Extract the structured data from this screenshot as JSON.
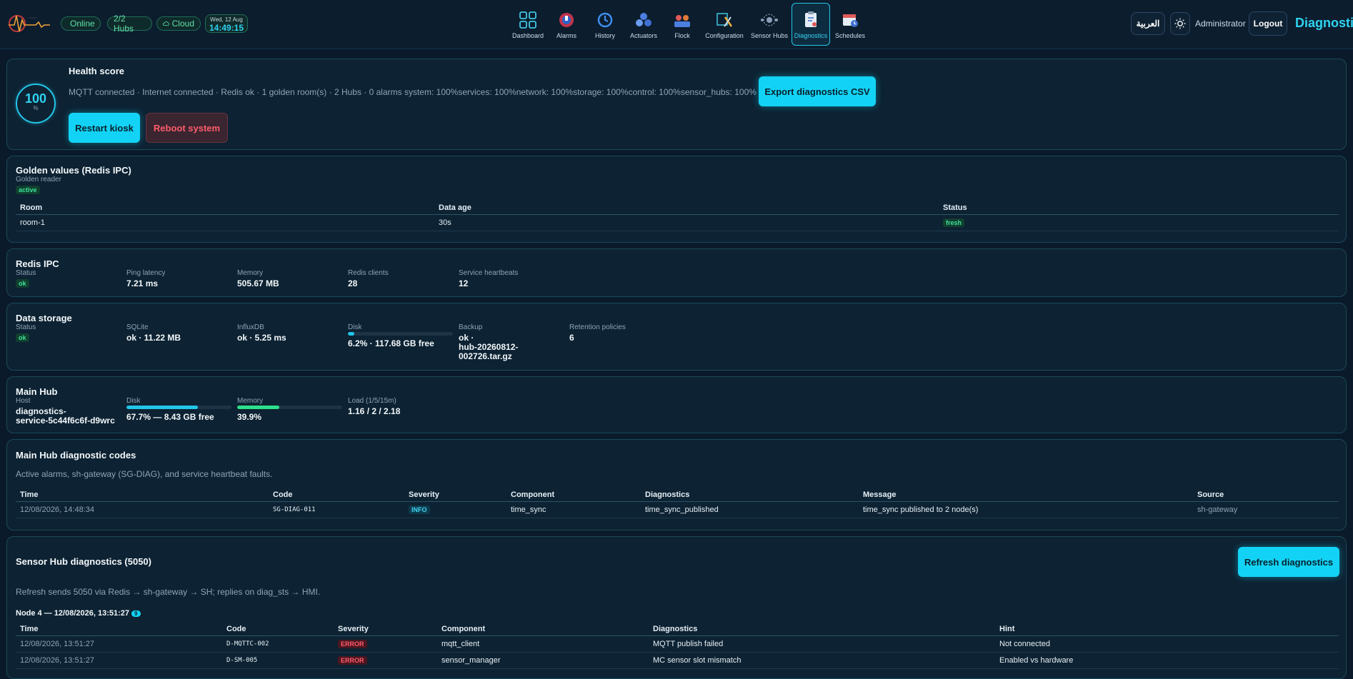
{
  "header": {
    "status_online": "Online",
    "hubs": "2/2 Hubs",
    "cloud": "Cloud",
    "date": "Wed, 12 Aug",
    "time": "14:49:15",
    "nav": [
      {
        "label": "Dashboard",
        "icon": "dashboard-icon"
      },
      {
        "label": "Alarms",
        "icon": "alarm-icon"
      },
      {
        "label": "History",
        "icon": "history-icon"
      },
      {
        "label": "Actuators",
        "icon": "actuators-icon"
      },
      {
        "label": "Flock",
        "icon": "flock-icon"
      },
      {
        "label": "Configuration",
        "icon": "configuration-icon"
      },
      {
        "label": "Sensor Hubs",
        "icon": "sensor-hubs-icon"
      },
      {
        "label": "Diagnostics",
        "icon": "diagnostics-icon",
        "active": true
      },
      {
        "label": "Schedules",
        "icon": "schedules-icon"
      }
    ],
    "language": "العربية",
    "user": "Administrator",
    "logout": "Logout",
    "page_title": "Diagnostics"
  },
  "health": {
    "title": "Health score",
    "score": "100",
    "unit": "%",
    "summary": "MQTT connected · Internet connected · Redis ok · 1 golden room(s) · 2 Hubs · 0 alarms system: 100%services: 100%network: 100%storage: 100%control: 100%sensor_hubs: 100%",
    "export_label": "Export diagnostics CSV",
    "restart_label": "Restart kiosk",
    "reboot_label": "Reboot system"
  },
  "golden": {
    "title": "Golden values (Redis IPC)",
    "reader_label": "Golden reader",
    "reader_status": "active",
    "columns": [
      "Room",
      "Data age",
      "Status"
    ],
    "rows": [
      {
        "room": "room-1",
        "age": "30s",
        "status": "fresh"
      }
    ]
  },
  "redis": {
    "title": "Redis IPC",
    "status_label": "Status",
    "status": "ok",
    "ping_label": "Ping latency",
    "ping": "7.21 ms",
    "memory_label": "Memory",
    "memory": "505.67 MB",
    "clients_label": "Redis clients",
    "clients": "28",
    "heartbeats_label": "Service heartbeats",
    "heartbeats": "12"
  },
  "storage": {
    "title": "Data storage",
    "status_label": "Status",
    "status": "ok",
    "sqlite_label": "SQLite",
    "sqlite": "ok · 11.22 MB",
    "influx_label": "InfluxDB",
    "influx": "ok · 5.25 ms",
    "disk_label": "Disk",
    "disk": "6.2% · 117.68 GB free",
    "disk_fraction": 0.062,
    "backup_label": "Backup",
    "backup_line1": "ok ·",
    "backup_line2": "hub-20260812-",
    "backup_line3": "002726.tar.gz",
    "retention_label": "Retention policies",
    "retention": "6"
  },
  "mainhub": {
    "title": "Main Hub",
    "host_label": "Host",
    "host_line1": "diagnostics-",
    "host_line2": "service-5c44f6c6f-d9wrc",
    "disk_label": "Disk",
    "disk": "67.7% — 8.43 GB free",
    "disk_fraction": 0.677,
    "memory_label": "Memory",
    "memory": "39.9%",
    "memory_fraction": 0.399,
    "load_label": "Load (1/5/15m)",
    "load": "1.16 / 2 / 2.18"
  },
  "codes": {
    "title": "Main Hub diagnostic codes",
    "description": "Active alarms, sh-gateway (SG-DIAG), and service heartbeat faults.",
    "columns": [
      "Time",
      "Code",
      "Severity",
      "Component",
      "Diagnostics",
      "Message",
      "Source"
    ],
    "rows": [
      {
        "time": "12/08/2026, 14:48:34",
        "code": "SG-DIAG-011",
        "severity": "INFO",
        "component": "time_sync",
        "diagnostics": "time_sync_published",
        "message": "time_sync published to 2 node(s)",
        "source": "sh-gateway"
      }
    ]
  },
  "sensorhub": {
    "title": "Sensor Hub diagnostics (5050)",
    "refresh_label": "Refresh diagnostics",
    "description": "Refresh sends 5050 via Redis → sh-gateway → SH; replies on diag_sts → HMI.",
    "node_title": "Node 4 — 12/08/2026, 13:51:27",
    "node_count": "9",
    "columns": [
      "Time",
      "Code",
      "Severity",
      "Component",
      "Diagnostics",
      "Hint"
    ],
    "rows": [
      {
        "time": "12/08/2026, 13:51:27",
        "code": "D-MQTTC-002",
        "severity": "ERROR",
        "component": "mqtt_client",
        "diagnostics": "MQTT publish failed",
        "hint": "Not connected"
      },
      {
        "time": "12/08/2026, 13:51:27",
        "code": "D-SM-005",
        "severity": "ERROR",
        "component": "sensor_manager",
        "diagnostics": "MC sensor slot mismatch",
        "hint": "Enabled vs hardware"
      }
    ]
  }
}
